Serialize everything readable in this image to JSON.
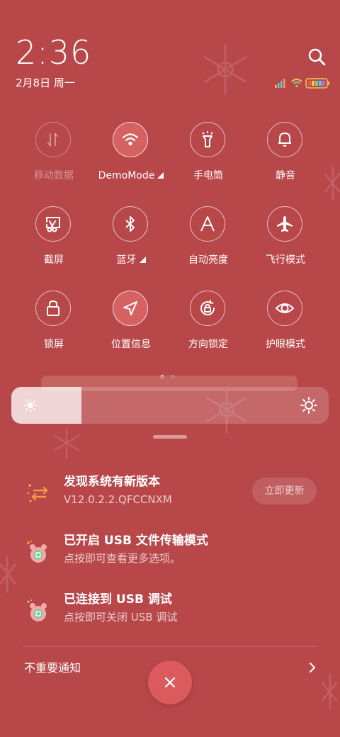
{
  "status_bar": {
    "time": "2:36",
    "date": "2月8日 周一"
  },
  "quick_tiles": [
    {
      "label": "移动数据",
      "icon": "mobile-data-icon",
      "state": "disabled"
    },
    {
      "label": "DemoMode",
      "icon": "wifi-icon",
      "state": "on",
      "expandable": true
    },
    {
      "label": "手电筒",
      "icon": "flashlight-icon",
      "state": "off"
    },
    {
      "label": "静音",
      "icon": "bell-icon",
      "state": "off"
    },
    {
      "label": "截屏",
      "icon": "screenshot-icon",
      "state": "off"
    },
    {
      "label": "蓝牙",
      "icon": "bluetooth-icon",
      "state": "off",
      "expandable": true
    },
    {
      "label": "自动亮度",
      "icon": "auto-brightness-icon",
      "state": "off"
    },
    {
      "label": "飞行模式",
      "icon": "airplane-icon",
      "state": "off"
    },
    {
      "label": "锁屏",
      "icon": "lock-icon",
      "state": "off"
    },
    {
      "label": "位置信息",
      "icon": "location-icon",
      "state": "on"
    },
    {
      "label": "方向锁定",
      "icon": "rotation-lock-icon",
      "state": "off"
    },
    {
      "label": "护眼模式",
      "icon": "eye-icon",
      "state": "off"
    }
  ],
  "page_indicator": {
    "current": 1,
    "total": 2
  },
  "brightness": {
    "level": 0.22
  },
  "notifications": [
    {
      "title": "发现系统有新版本",
      "text": "V12.0.2.2.QFCCNXM",
      "action": "立即更新",
      "icon": "system-update-icon"
    },
    {
      "title": "已开启 USB 文件传输模式",
      "text": "点按即可查看更多选项。",
      "icon": "usb-app-icon"
    },
    {
      "title": "已连接到 USB 调试",
      "text": "点按即可关闭 USB 调试",
      "icon": "usb-app-icon"
    }
  ],
  "footer": {
    "unimportant_label": "不重要通知"
  },
  "colors": {
    "background": "#b8474a",
    "tile_active": "#d66163",
    "close_button": "#db5a5d"
  }
}
